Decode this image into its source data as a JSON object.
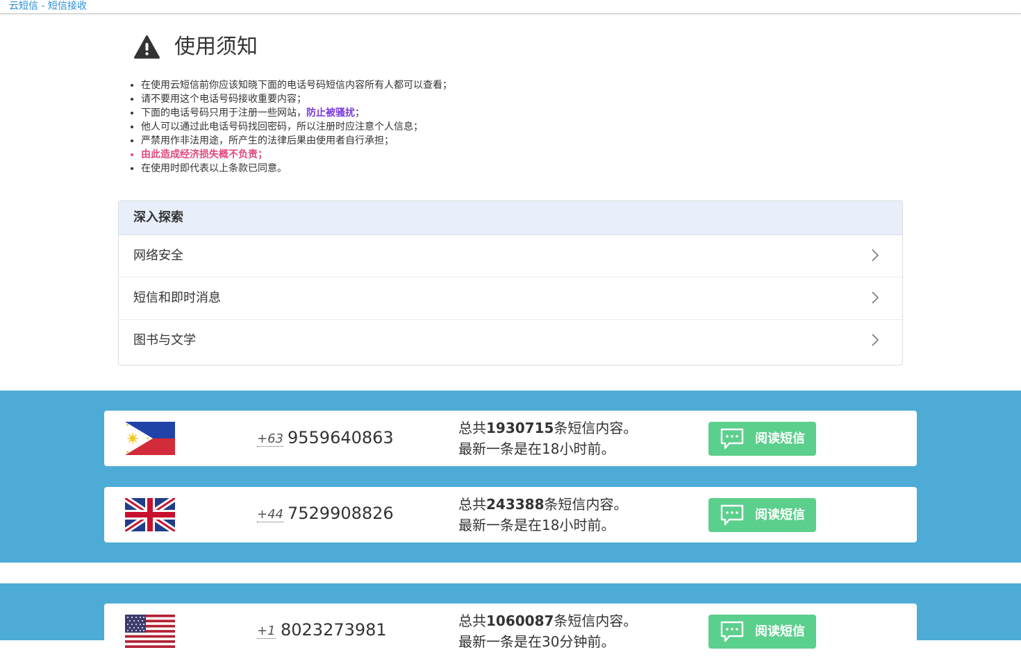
{
  "header": {
    "site_title": "云短信 - 短信接收"
  },
  "notice": {
    "title": "使用须知",
    "items": [
      "在使用云短信前你应该知晓下面的电话号码短信内容所有人都可以查看；",
      "请不要用这个电话号码接收重要内容；",
      "下面的电话号码只用于注册一些网站，",
      "防止被骚扰",
      "；",
      "他人可以通过此电话号码找回密码，所以注册时应注意个人信息；",
      "严禁用作非法用途，所产生的法律后果由使用者自行承担；",
      "由此造成经济损失概不负责；",
      "在使用时即代表以上条款已同意。"
    ]
  },
  "explore": {
    "heading": "深入探索",
    "items": [
      "网络安全",
      "短信和即时消息",
      "图书与文学"
    ]
  },
  "numbers": [
    {
      "country": "Philippines",
      "flag_icon": "philippines-flag-icon",
      "code": "+63",
      "number": "9559640863",
      "total_prefix": "总共",
      "total": "1930715",
      "total_suffix": "条短信内容。",
      "latest": "最新一条是在18小时前。",
      "button": "阅读短信"
    },
    {
      "country": "United Kingdom",
      "flag_icon": "uk-flag-icon",
      "code": "+44",
      "number": "7529908826",
      "total_prefix": "总共",
      "total": "243388",
      "total_suffix": "条短信内容。",
      "latest": "最新一条是在18小时前。",
      "button": "阅读短信"
    },
    {
      "country": "United States",
      "flag_icon": "us-flag-icon",
      "code": "+1",
      "number": "8023273981",
      "total_prefix": "总共",
      "total": "1060087",
      "total_suffix": "条短信内容。",
      "latest": "最新一条是在30分钟前。",
      "button": "阅读短信"
    }
  ],
  "colors": {
    "band": "#4eabd6",
    "button": "#5bcf8c",
    "link": "#2a8fd6",
    "purple": "#7a3bd9",
    "pink": "#e04a7a"
  }
}
